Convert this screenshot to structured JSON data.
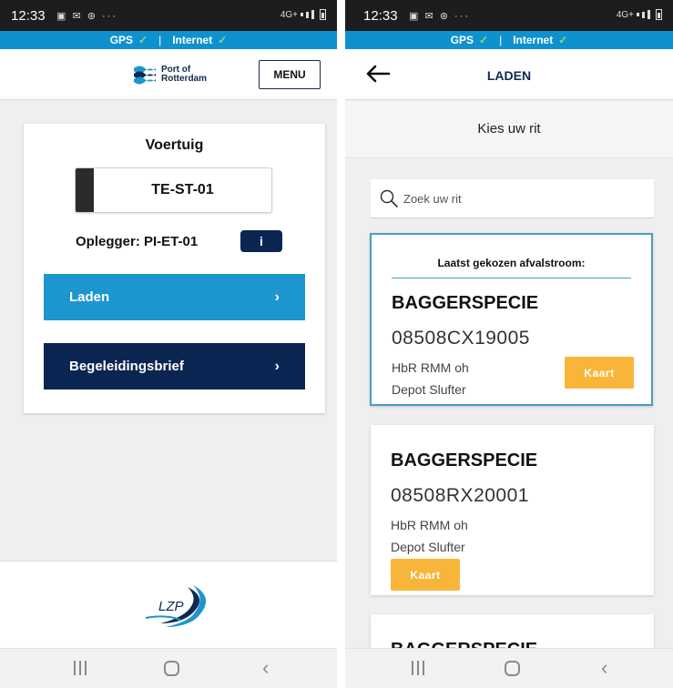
{
  "status_bar": {
    "time": "12:33",
    "icons": "▣ ✉ ⊛ ···",
    "network": "4G+"
  },
  "connectivity": {
    "gps_label": "GPS",
    "separator": "|",
    "internet_label": "Internet",
    "check": "✓"
  },
  "left_screen": {
    "brand": {
      "line1": "Port of",
      "line2": "Rotterdam"
    },
    "menu_label": "MENU",
    "vehicle_card": {
      "title": "Voertuig",
      "plate": "TE-ST-01",
      "trailer": "Oplegger: PI-ET-01",
      "info_label": "i"
    },
    "actions": [
      {
        "label": "Laden",
        "chevron": "›"
      },
      {
        "label": "Begeleidingsbrief",
        "chevron": "›"
      }
    ],
    "footer_logo_text": "LZP"
  },
  "right_screen": {
    "title": "LADEN",
    "back_arrow": "←",
    "subheader": "Kies uw rit",
    "search": {
      "placeholder": "Zoek uw rit"
    },
    "last_chosen_label": "Laatst gekozen afvalstroom:",
    "rides": [
      {
        "type": "BAGGERSPECIE",
        "code": "08508CX19005",
        "location_line1": "HbR RMM oh",
        "location_line2": "Depot Slufter",
        "button": "Kaart"
      },
      {
        "type": "BAGGERSPECIE",
        "code": "08508RX20001",
        "location_line1": "HbR RMM oh",
        "location_line2": "Depot Slufter",
        "button": "Kaart"
      },
      {
        "type": "BAGGERSPECIE"
      }
    ]
  },
  "colors": {
    "status_bar": "#1d1d1f",
    "connectivity_bar": "#0d92cf",
    "laden_button": "#1d95cf",
    "navy": "#0b2552",
    "kaart_button": "#f9b53a",
    "highlight_border": "#4a9fbc"
  },
  "nav_icons": [
    "recents-icon",
    "home-icon",
    "back-icon"
  ]
}
